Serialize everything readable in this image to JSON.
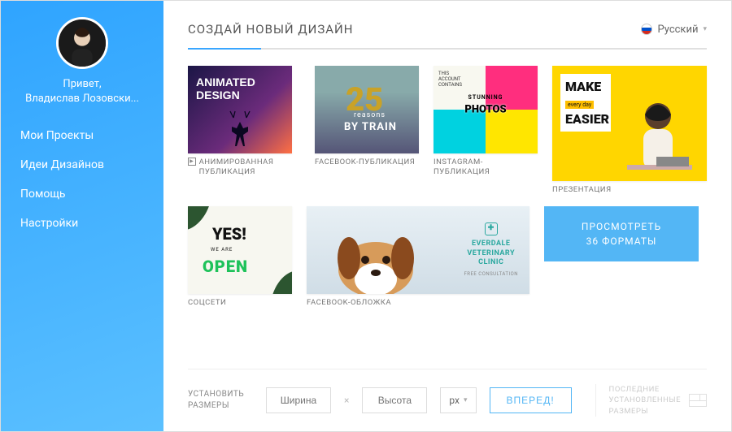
{
  "sidebar": {
    "greeting_line1": "Привет,",
    "greeting_line2": "Владислав Лозовски...",
    "nav": [
      {
        "label": "Мои Проекты"
      },
      {
        "label": "Идеи Дизайнов"
      },
      {
        "label": "Помощь"
      },
      {
        "label": "Настройки"
      }
    ]
  },
  "header": {
    "title": "СОЗДАЙ НОВЫЙ ДИЗАЙН",
    "language": "Русский"
  },
  "templates": {
    "row1": [
      {
        "label": "АНИМИРОВАННАЯ ПУБЛИКАЦИЯ",
        "animated": true
      },
      {
        "label": "FACEBOOK-ПУБЛИКАЦИЯ"
      },
      {
        "label": "INSTAGRAM-ПУБЛИКАЦИЯ"
      },
      {
        "label": "ПРЕЗЕНТАЦИЯ"
      }
    ],
    "row2": [
      {
        "label": "СОЦСЕТИ"
      },
      {
        "label": "FACEBOOK-ОБЛОЖКА"
      }
    ],
    "art": {
      "anim_title": "ANIMATED\nDESIGN",
      "fb_num": "25",
      "fb_sub": "reasons",
      "fb_sub2": "BY TRAIN",
      "insta_top": "STUNNING",
      "insta_big": "PHOTOS",
      "insta_account": "THIS\nACCOUNT\nCONTAINS",
      "pres_l1": "MAKE",
      "pres_l2": "every day",
      "pres_l3": "EASIER",
      "social_yes": "YES!",
      "social_we": "WE   ARE",
      "social_open": "OPEN",
      "clinic_name": "EVERDALE\nVETERINARY\nCLINIC",
      "clinic_fc": "FREE CONSULTATION"
    }
  },
  "cta": {
    "line1": "ПРОСМОТРЕТЬ",
    "line2": "36 ФОРМАТЫ"
  },
  "custom": {
    "label": "УСТАНОВИТЬ\nРАЗМЕРЫ",
    "width_ph": "Ширина",
    "height_ph": "Высота",
    "unit": "px",
    "go": "ВПЕРЕД!",
    "recent_label": "ПОСЛЕДНИЕ\nУСТАНОВЛЕННЫЕ\nРАЗМЕРЫ"
  }
}
